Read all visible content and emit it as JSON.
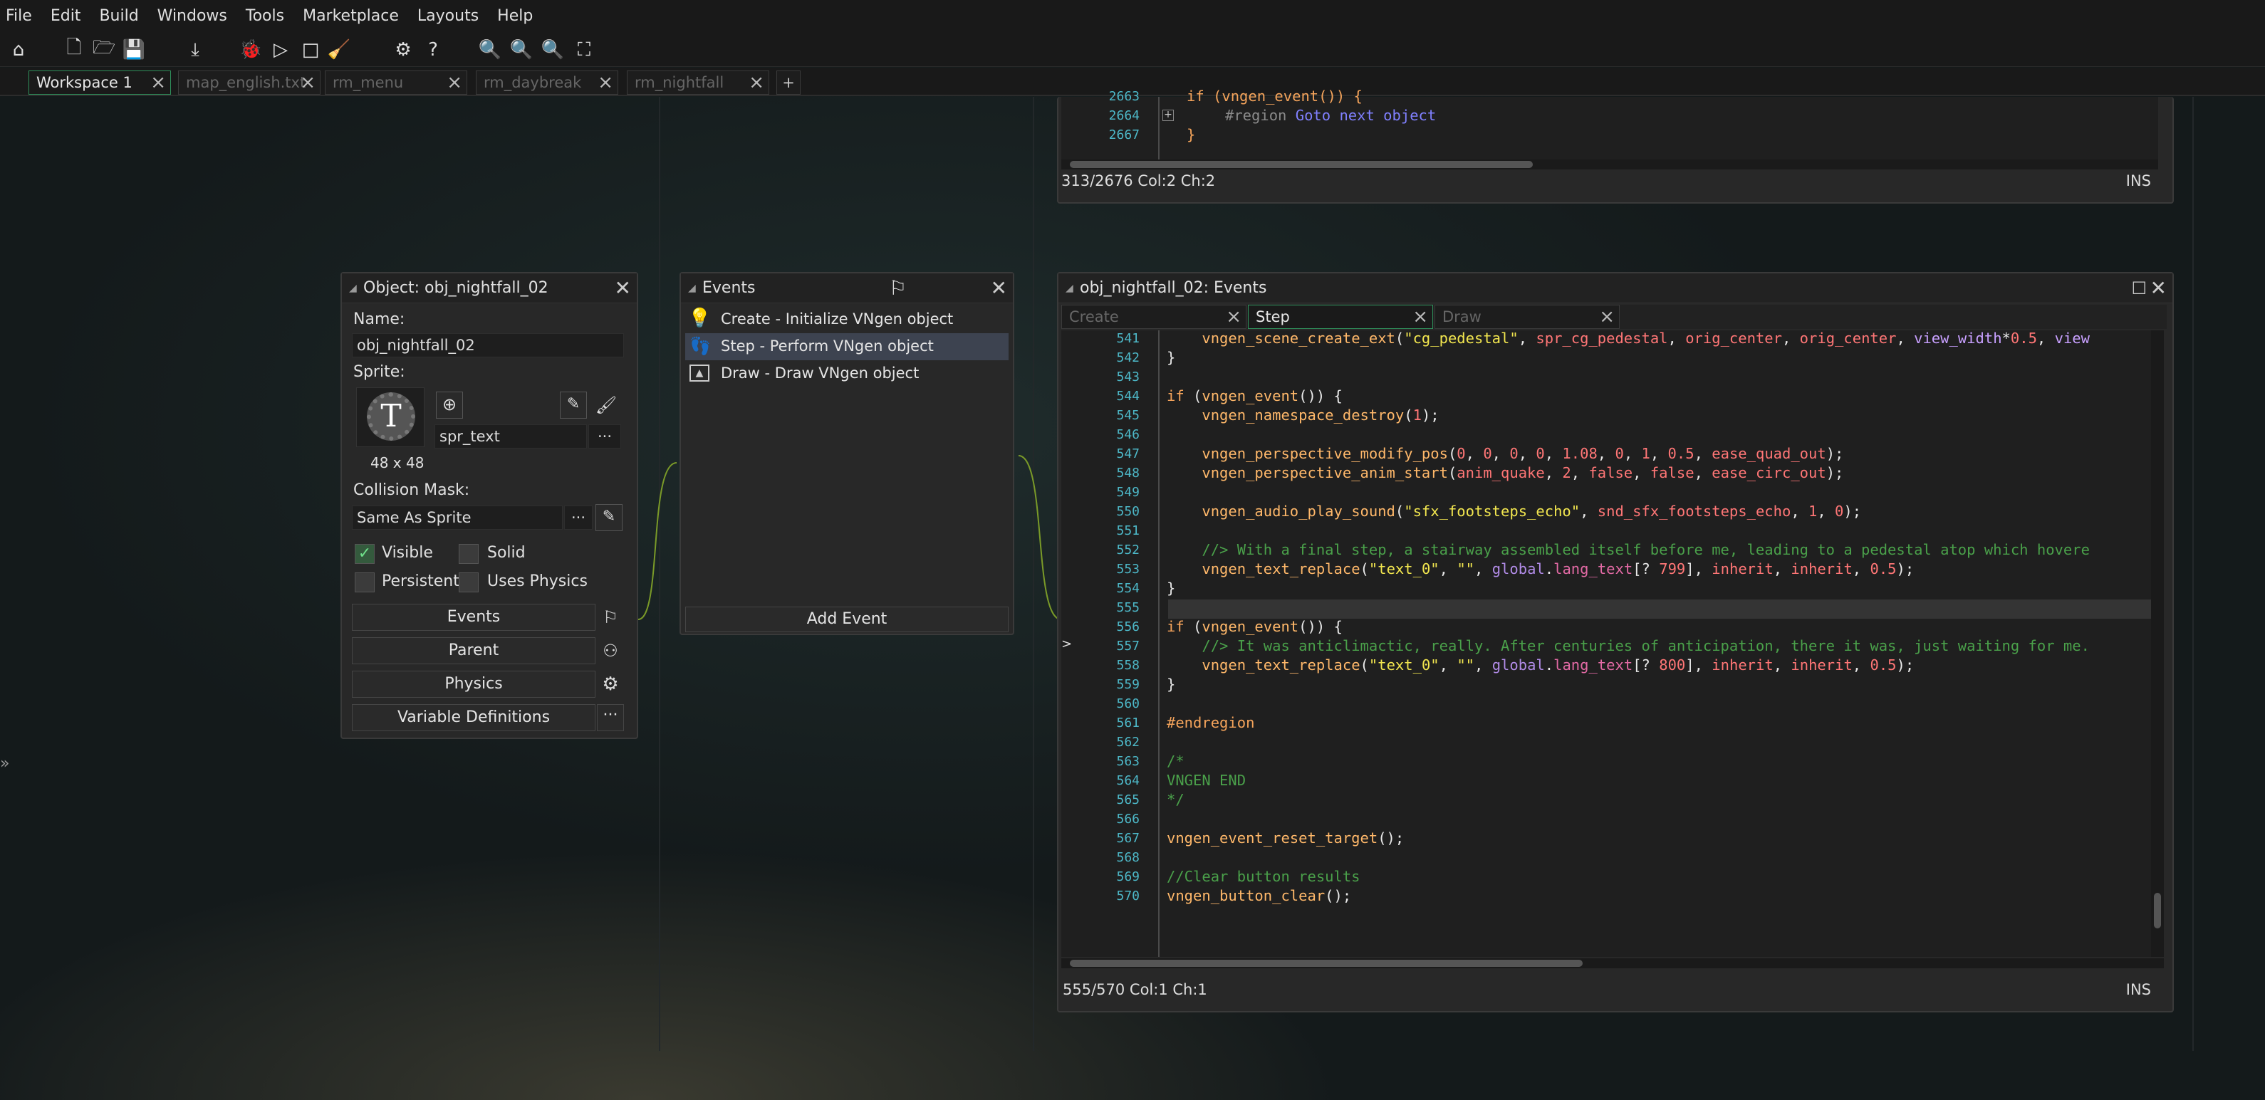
{
  "menu": [
    "File",
    "Edit",
    "Build",
    "Windows",
    "Tools",
    "Marketplace",
    "Layouts",
    "Help"
  ],
  "toolbar_icons": [
    "home-icon",
    "new-file-icon",
    "open-folder-icon",
    "save-icon",
    "export-icon",
    "debug-icon",
    "run-icon",
    "stop-icon",
    "clean-icon",
    "settings-icon",
    "help-icon",
    "zoom-out-icon",
    "zoom-reset-icon",
    "zoom-in-icon",
    "fit-icon"
  ],
  "tabs": [
    {
      "label": "Workspace 1",
      "active": true
    },
    {
      "label": "map_english.txt"
    },
    {
      "label": "rm_menu"
    },
    {
      "label": "rm_daybreak"
    },
    {
      "label": "rm_nightfall"
    }
  ],
  "tab_add": "+",
  "sidebar_toggle": "»",
  "top_editor": {
    "lines": [
      {
        "n": "2663",
        "t": "if (vngen_event()) {"
      },
      {
        "n": "2664",
        "t": "#region Goto next object"
      },
      {
        "n": "2667",
        "t": "}"
      }
    ],
    "status": "313/2676 Col:2 Ch:2",
    "mode": "INS"
  },
  "object_panel": {
    "title": "Object: obj_nightfall_02",
    "name_label": "Name:",
    "name_value": "obj_nightfall_02",
    "sprite_label": "Sprite:",
    "sprite_glyph": "T",
    "sprite_value": "spr_text",
    "sprite_size": "48 x 48",
    "mask_label": "Collision Mask:",
    "mask_value": "Same As Sprite",
    "ellipsis": "···",
    "visible": "Visible",
    "solid": "Solid",
    "persistent": "Persistent",
    "uses_physics": "Uses Physics",
    "visible_checked": true,
    "events_btn": "Events",
    "parent_btn": "Parent",
    "physics_btn": "Physics",
    "vardefs_btn": "Variable Definitions"
  },
  "events_panel": {
    "title": "Events",
    "items": [
      {
        "label": "Create - Initialize VNgen object",
        "icon": "lightbulb-icon"
      },
      {
        "label": "Step - Perform VNgen object",
        "icon": "footsteps-icon",
        "selected": true
      },
      {
        "label": "Draw - Draw VNgen object",
        "icon": "draw-icon"
      }
    ],
    "add_event": "Add Event"
  },
  "code_panel": {
    "title": "obj_nightfall_02: Events",
    "tabs": [
      {
        "label": "Create"
      },
      {
        "label": "Step",
        "active": true
      },
      {
        "label": "Draw"
      }
    ],
    "gutter_marker": ">",
    "line_numbers": [
      "541",
      "542",
      "543",
      "544",
      "545",
      "546",
      "547",
      "548",
      "549",
      "550",
      "551",
      "552",
      "553",
      "554",
      "555",
      "556",
      "557",
      "558",
      "559",
      "560",
      "561",
      "562",
      "563",
      "564",
      "565",
      "566",
      "567",
      "568",
      "569",
      "570"
    ],
    "status": "555/570 Col:1 Ch:1",
    "mode": "INS"
  }
}
